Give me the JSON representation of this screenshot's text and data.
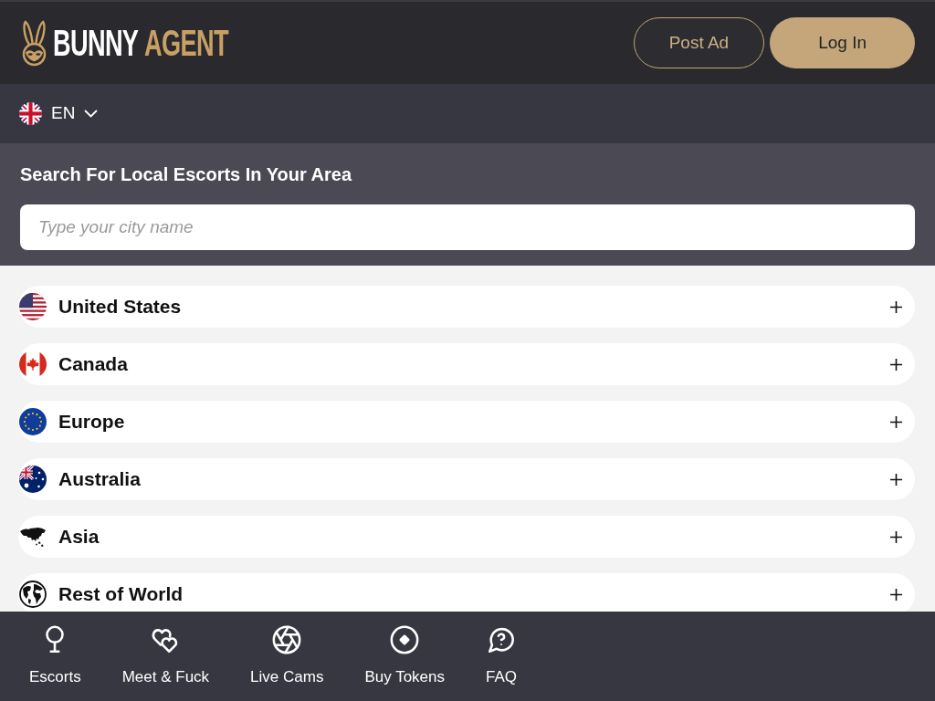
{
  "header": {
    "logo": {
      "word_1": "BUNNY",
      "word_2": "AGENT"
    },
    "buttons": [
      {
        "label": "Post Ad",
        "kind": "outline"
      },
      {
        "label": "Log In",
        "kind": "filled"
      }
    ]
  },
  "language_selector": {
    "code": "EN",
    "expanded": false
  },
  "search": {
    "title": "Search For Local Escorts In Your Area",
    "placeholder": "Type your city name"
  },
  "regions": [
    {
      "name": "United States",
      "expanded": false
    },
    {
      "name": "Canada",
      "expanded": false
    },
    {
      "name": "Europe",
      "expanded": false
    },
    {
      "name": "Australia",
      "expanded": false
    },
    {
      "name": "Asia",
      "expanded": false
    },
    {
      "name": "Rest of World",
      "expanded": false
    }
  ],
  "bottom_nav": [
    {
      "label": "Escorts"
    },
    {
      "label": "Meet & Fuck"
    },
    {
      "label": "Live Cams"
    },
    {
      "label": "Buy Tokens"
    },
    {
      "label": "FAQ"
    }
  ]
}
